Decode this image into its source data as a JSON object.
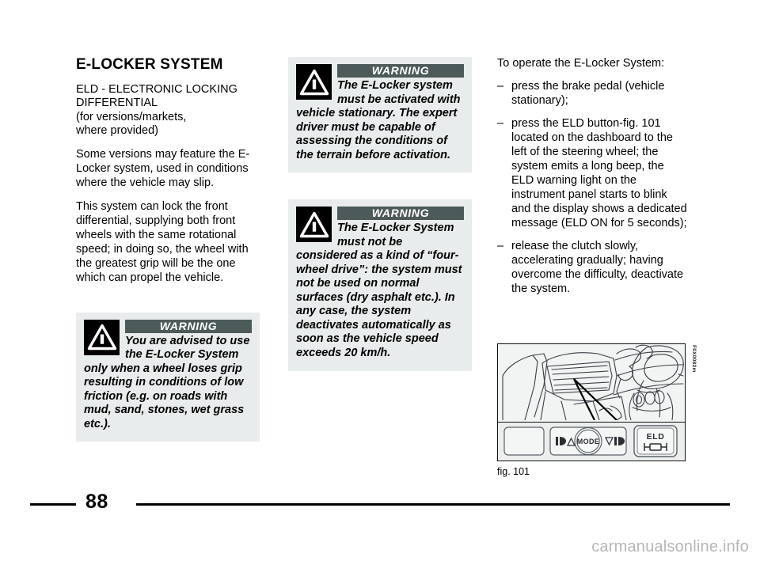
{
  "document": {
    "page_number": "88",
    "watermark": "carmanualsonline.info"
  },
  "left_column": {
    "section_title": "E-LOCKER SYSTEM",
    "subhead_lines": [
      "ELD - ELECTRONIC LOCKING",
      "DIFFERENTIAL",
      "(for versions/markets,",
      "where provided)"
    ],
    "subhead": "ELD - ELECTRONIC LOCKING DIFFERENTIAL (for versions/markets, where provided)",
    "paragraph_1": "Some versions may feature the E-Locker system, used in conditions where the vehicle may slip.",
    "paragraph_2": "This system can lock the front differential, supplying both front wheels with the same rotational speed; in doing so, the wheel with the greatest grip will be the one which can propel the vehicle.",
    "warning": {
      "label": "WARNING",
      "icon": "warning-triangle-icon",
      "text": "You are advised to use the E-Locker System only when a wheel loses grip resulting in conditions of low friction (e.g. on roads with mud, sand, stones, wet grass etc.)."
    }
  },
  "middle_column": {
    "warning_1": {
      "label": "WARNING",
      "icon": "warning-triangle-icon",
      "text": "The E-Locker system must be activated with vehicle stationary. The expert driver must be capable of assessing the conditions of the terrain before activation."
    },
    "warning_2": {
      "label": "WARNING",
      "icon": "warning-triangle-icon",
      "text": "The E-Locker System must not be considered as a kind of “four-wheel drive”: the system must not be used on normal surfaces (dry asphalt etc.). In any case, the system deactivates automatically as soon as the vehicle speed exceeds 20 km/h."
    }
  },
  "right_column": {
    "intro": "To operate the E-Locker System:",
    "dash": "–",
    "steps": [
      "press the brake pedal (vehicle stationary);",
      "press the ELD button-fig. 101 located on the dashboard to the left of the steering wheel; the system emits a long beep, the ELD warning light on the instrument panel starts to blink and the display shows a dedicated message (ELD ON for 5 seconds);",
      "release the clutch slowly, accelerating gradually; having overcome the difficulty, deactivate the system."
    ],
    "figure": {
      "caption": "fig. 101",
      "reference_code": "F0X0082m",
      "panel_buttons": [
        {
          "name": "blank-button",
          "label": ""
        },
        {
          "name": "headlight-up-button",
          "label": "∆"
        },
        {
          "name": "mode-button",
          "label": "MODE"
        },
        {
          "name": "headlight-down-button",
          "label": "∇"
        },
        {
          "name": "eld-button",
          "label": "ELD"
        }
      ]
    }
  },
  "colors": {
    "panel_background": "#e9ecec",
    "warning_header": "#4d5a5a",
    "warning_icon_background": "#000000",
    "text": "#000000",
    "watermark": "#b6b6b6"
  }
}
